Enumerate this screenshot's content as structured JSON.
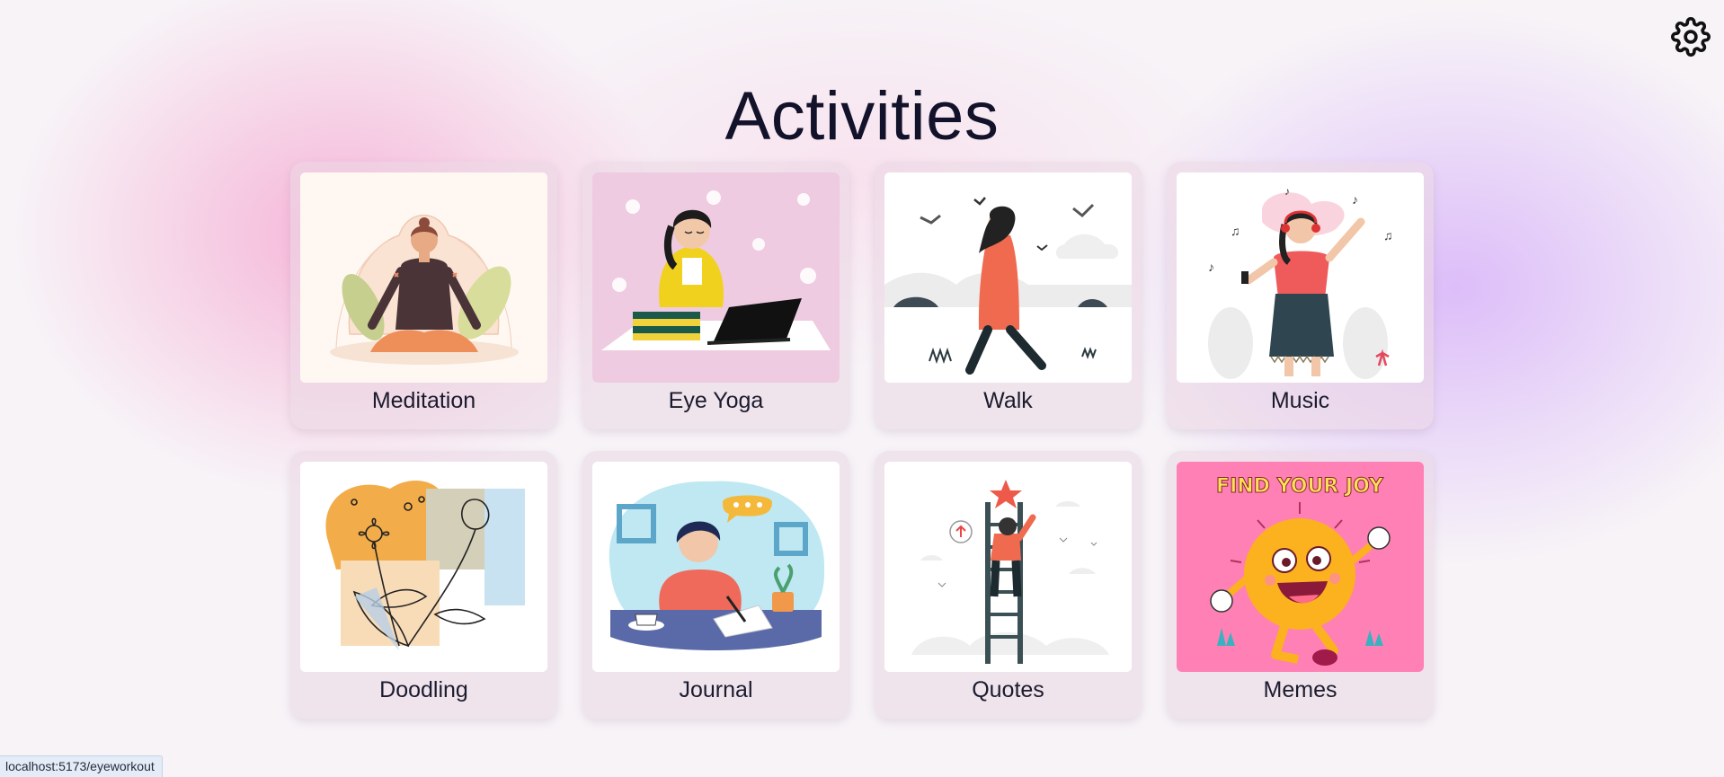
{
  "page": {
    "title": "Activities"
  },
  "settings": {
    "icon": "gear-icon"
  },
  "activities": [
    {
      "label": "Meditation",
      "illustration": "meditation"
    },
    {
      "label": "Eye Yoga",
      "illustration": "eye-yoga"
    },
    {
      "label": "Walk",
      "illustration": "walk"
    },
    {
      "label": "Music",
      "illustration": "music"
    },
    {
      "label": "Doodling",
      "illustration": "doodling"
    },
    {
      "label": "Journal",
      "illustration": "journal"
    },
    {
      "label": "Quotes",
      "illustration": "quotes"
    },
    {
      "label": "Memes",
      "illustration": "memes"
    }
  ],
  "memes_banner": "FIND YOUR JOY",
  "status_bar": {
    "url": "localhost:5173/eyeworkout"
  },
  "colors": {
    "pink_glow": "#f6a0cd",
    "purple_glow": "#d6b0fa",
    "text": "#12122a",
    "memes_bg": "#ff7eb3"
  }
}
